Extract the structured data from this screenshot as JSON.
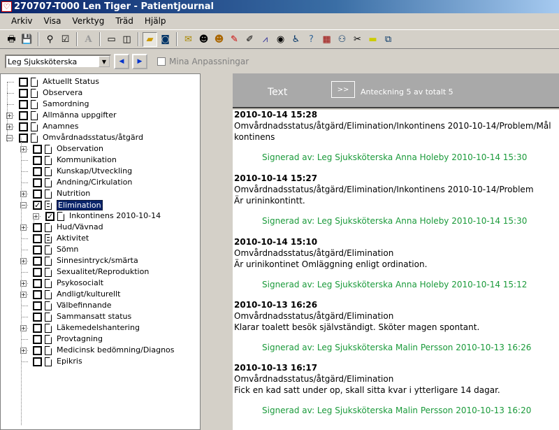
{
  "window": {
    "title": "270707-T000 Len Tiger - Patientjournal"
  },
  "menu": [
    "Arkiv",
    "Visa",
    "Verktyg",
    "Träd",
    "Hjälp"
  ],
  "toolbar_icons": [
    "print-icon",
    "save-icon",
    "binoculars-icon",
    "check-icon",
    "font-icon",
    "window-icon",
    "window-split-icon",
    "folder-icon",
    "globe-icon",
    "envelope-icon",
    "people-icon",
    "people-alert-icon",
    "pen-icon",
    "note-icon",
    "chart-icon",
    "eye-icon",
    "wheelchair-icon",
    "question-icon",
    "table-icon",
    "family-icon",
    "pill-icon",
    "sticky-note-icon",
    "window-alert-icon"
  ],
  "role": {
    "selected": "Leg Sjuksköterska",
    "mina_anpassningar": "Mina Anpassningar"
  },
  "tree": {
    "items": [
      {
        "label": "Aktuellt Status"
      },
      {
        "label": "Observera"
      },
      {
        "label": "Samordning"
      },
      {
        "label": "Allmänna uppgifter"
      },
      {
        "label": "Anamnes"
      },
      {
        "label": "Omvårdnadsstatus/åtgärd"
      },
      {
        "label": "Observation"
      },
      {
        "label": "Kommunikation"
      },
      {
        "label": "Kunskap/Utveckling"
      },
      {
        "label": "Andning/Cirkulation"
      },
      {
        "label": "Nutrition"
      },
      {
        "label": "Elimination"
      },
      {
        "label": "Inkontinens 2010-10-14"
      },
      {
        "label": "Hud/Vävnad"
      },
      {
        "label": "Aktivitet"
      },
      {
        "label": "Sömn"
      },
      {
        "label": "Sinnesintryck/smärta"
      },
      {
        "label": "Sexualitet/Reproduktion"
      },
      {
        "label": "Psykosocialt"
      },
      {
        "label": "Andligt/kulturellt"
      },
      {
        "label": "Välbefinnande"
      },
      {
        "label": "Sammansatt status"
      },
      {
        "label": "Läkemedelshantering"
      },
      {
        "label": "Provtagning"
      },
      {
        "label": "Medicinsk bedömning/Diagnos"
      },
      {
        "label": "Epikris"
      }
    ]
  },
  "header": {
    "text": "Text",
    "next_button": ">>",
    "count": "Anteckning 5 av totalt 5"
  },
  "notes": [
    {
      "date": "2010-10-14 15:28",
      "lines": [
        "Omvårdnadsstatus/åtgärd/Elimination/Inkontinens 2010-10-14/Problem/Mål",
        "kontinens"
      ],
      "signature": "Signerad av: Leg Sjuksköterska Anna Holeby 2010-10-14 15:30"
    },
    {
      "date": "2010-10-14 15:27",
      "lines": [
        "Omvårdnadsstatus/åtgärd/Elimination/Inkontinens 2010-10-14/Problem",
        "Är urininkontintt."
      ],
      "signature": "Signerad av: Leg Sjuksköterska Anna Holeby 2010-10-14 15:30"
    },
    {
      "date": "2010-10-14 15:10",
      "lines": [
        "Omvårdnadsstatus/åtgärd/Elimination",
        "Är urinikontinet Omläggning enligt ordination."
      ],
      "signature": "Signerad av: Leg Sjuksköterska Anna Holeby 2010-10-14 15:12"
    },
    {
      "date": "2010-10-13 16:26",
      "lines": [
        "Omvårdnadsstatus/åtgärd/Elimination",
        "Klarar toalett besök självständigt. Sköter magen spontant."
      ],
      "signature": "Signerad av: Leg Sjuksköterska Malin Persson 2010-10-13 16:26"
    },
    {
      "date": "2010-10-13 16:17",
      "lines": [
        "Omvårdnadsstatus/åtgärd/Elimination",
        "Fick en kad satt under op, skall sitta kvar i ytterligare 14 dagar."
      ],
      "signature": "Signerad av: Leg Sjuksköterska Malin Persson 2010-10-13 16:20"
    }
  ]
}
